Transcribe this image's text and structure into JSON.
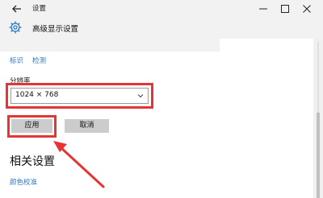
{
  "window": {
    "title": "设置",
    "back_icon": "back-arrow-icon",
    "controls": [
      "minimize-icon",
      "maximize-icon",
      "close-icon"
    ]
  },
  "header": {
    "icon": "gear-icon",
    "title": "高级显示设置"
  },
  "links": [
    "标识",
    "检测"
  ],
  "resolution": {
    "label": "分辨率",
    "selected": "1024 × 768"
  },
  "buttons": {
    "apply": "应用",
    "cancel": "取消"
  },
  "related": {
    "title": "相关设置",
    "link": "颜色校准"
  },
  "colors": {
    "accent": "#2b78c4",
    "highlight": "#e53434"
  },
  "annotations": [
    "highlight-box",
    "highlight-box",
    "annotation-arrow"
  ]
}
